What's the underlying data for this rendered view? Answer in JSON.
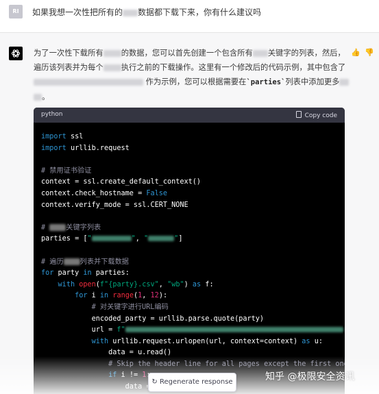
{
  "user": {
    "avatar": "RI",
    "message_part1": "如果我想一次性把所有的",
    "message_part2": "数据都下载下来，你有什么建议吗"
  },
  "reply": {
    "line1_a": "为了一次性下载所有",
    "line1_b": "的数据，您可以首先创建一个包含所有",
    "line1_c": "关键字的列表，然后，",
    "line2_a": "遍历该列表并为每个",
    "line2_b": "执行之前的下载操作。这里有一个修改后的代码示例，其中包含了",
    "line3_a": "作为示例，您可以根据需要在",
    "line3_code": "`parties`",
    "line3_b": "列表中添加更多",
    "line4": "。"
  },
  "code": {
    "lang": "python",
    "copy_label": "Copy code"
  },
  "regenerate_label": "Regenerate response",
  "watermark": "知乎 @极限安全资讯",
  "colors": {
    "code_bg": "#000000",
    "header_bg": "#343541",
    "keyword": "#2e95d3",
    "string": "#00a67d",
    "number": "#df3079",
    "comment": "#8e8ea0"
  }
}
